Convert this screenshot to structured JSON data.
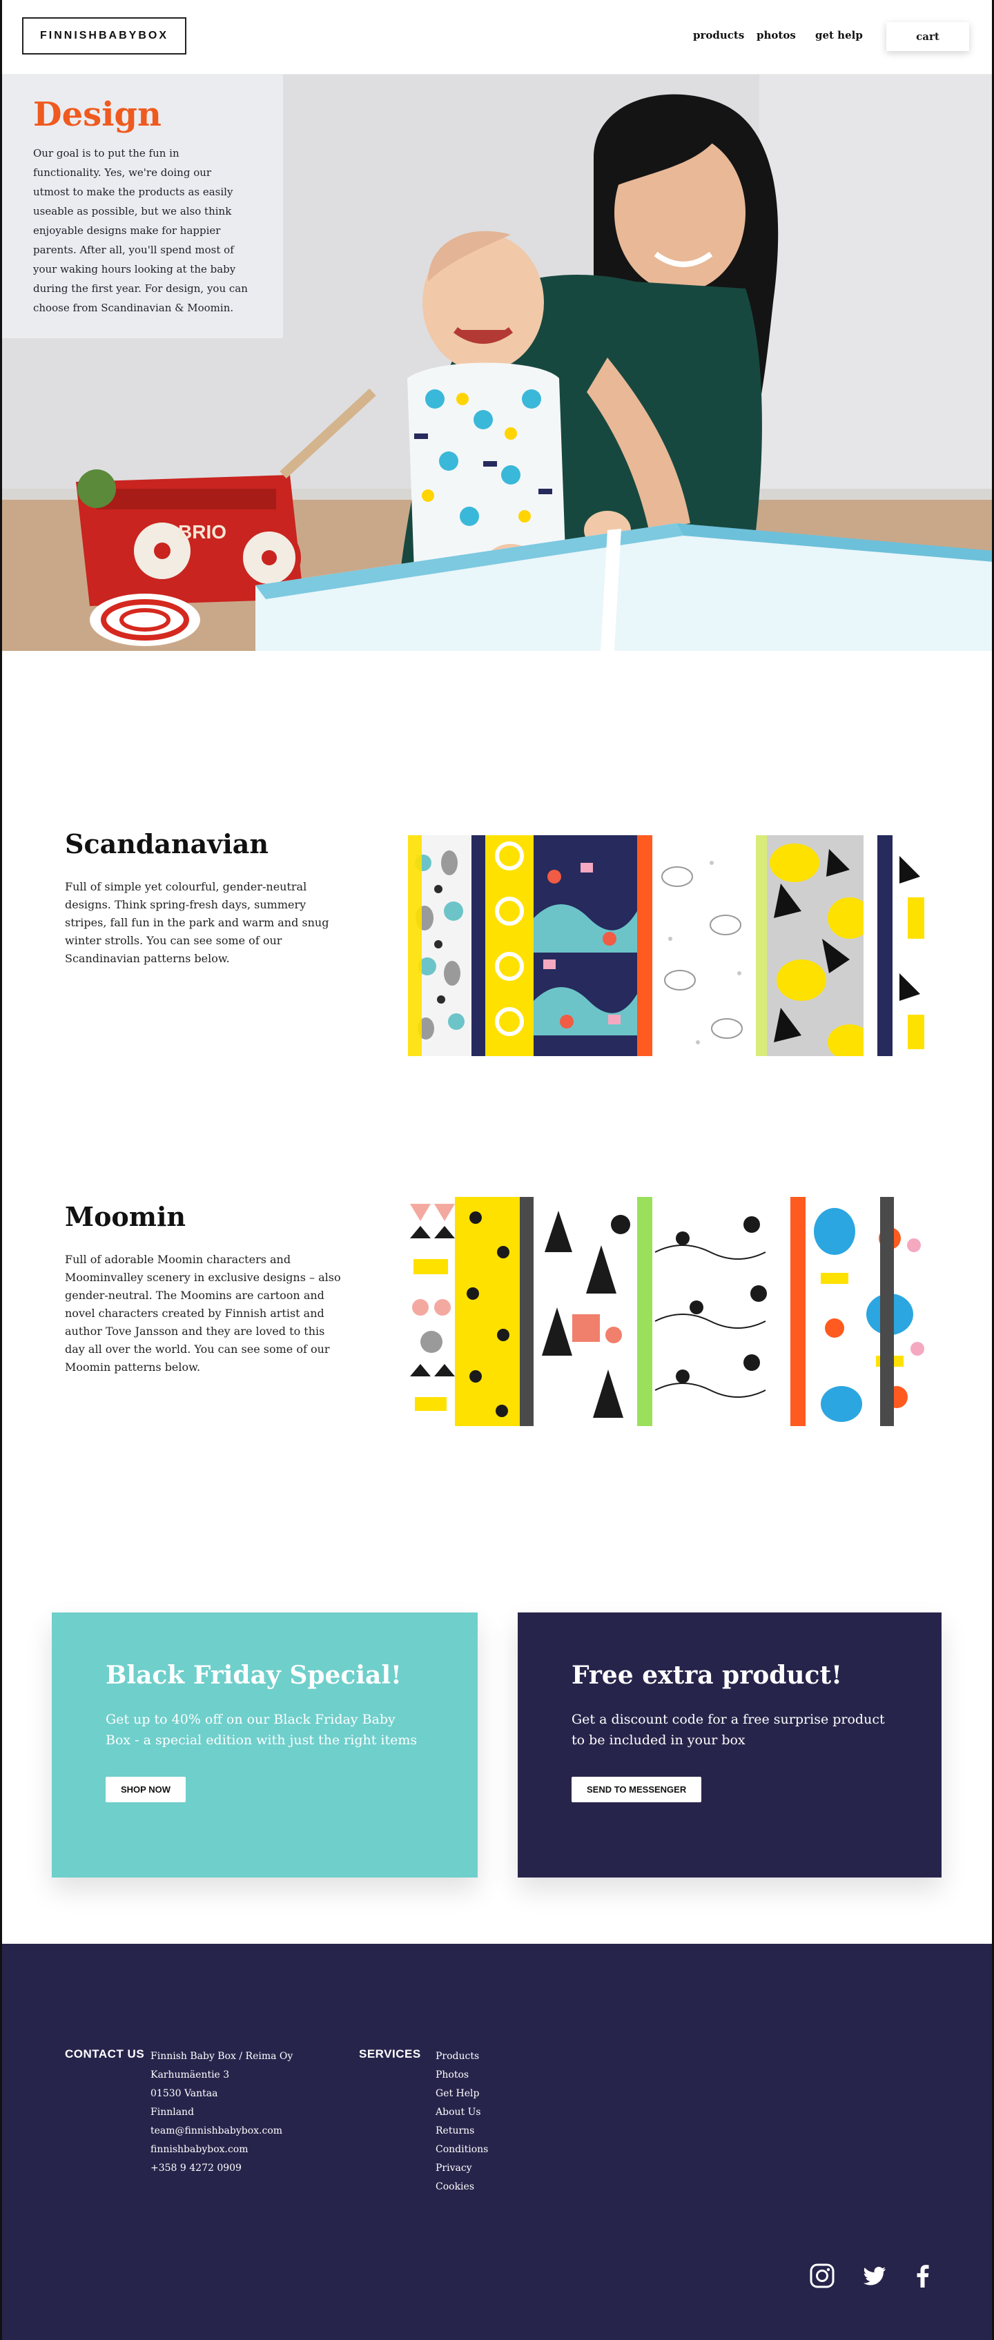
{
  "header": {
    "logo": "FINNISHBABYBOX",
    "nav": [
      "products",
      "photos",
      "get help"
    ],
    "cart": "cart"
  },
  "hero": {
    "title": "Design",
    "text": "Our goal is to put the fun in functionality. Yes, we're doing our utmost to make the products as easily useable as possible, but we also think enjoyable designs make for happier parents. After all, you'll spend most of your waking hours looking at the baby during the first year. For design, you can choose from Scandinavian & Moomin.",
    "toy_label": "BRIO"
  },
  "scandinavian": {
    "title": "Scandanavian",
    "text": "Full of simple yet colourful, gender-neutral designs. Think spring-fresh days, summery stripes, fall fun in the park and warm and snug winter strolls. You can see some of our Scandinavian patterns below."
  },
  "moomin": {
    "title": "Moomin",
    "text": "Full of adorable Moomin characters and Moominvalley scenery in exclusive designs – also gender-neutral. The Moomins are cartoon and novel characters created by Finnish artist and author Tove Jansson and they are loved to this day all over the world. You can see some of our Moomin patterns below."
  },
  "promos": [
    {
      "title": "Black Friday Special!",
      "text": "Get up to 40% off on our Black Friday Baby Box - a special edition with just the right items",
      "button": "SHOP NOW",
      "bg": "#6fcfcb"
    },
    {
      "title": "Free extra product!",
      "text": "Get a discount code for a free surprise product to be included in your box",
      "button": "SEND TO MESSENGER",
      "bg": "#27244b"
    }
  ],
  "footer": {
    "contact_heading": "CONTACT US",
    "contact_lines": [
      "Finnish Baby Box / Reima Oy",
      "Karhumäentie 3",
      "01530 Vantaa",
      "Finnland",
      "team@finnishbabybox.com",
      "finnishbabybox.com",
      "+358 9 4272 0909"
    ],
    "services_heading": "SERVICES",
    "services_links": [
      "Products",
      "Photos",
      "Get Help",
      "About Us",
      "Returns",
      "Conditions",
      "Privacy",
      "Cookies"
    ],
    "social_icons": [
      "instagram-icon",
      "twitter-icon",
      "facebook-icon"
    ]
  },
  "colors": {
    "accent": "#ef5a1f",
    "navy": "#27244b",
    "teal": "#6fcfcb",
    "yellow": "#ffe100"
  }
}
